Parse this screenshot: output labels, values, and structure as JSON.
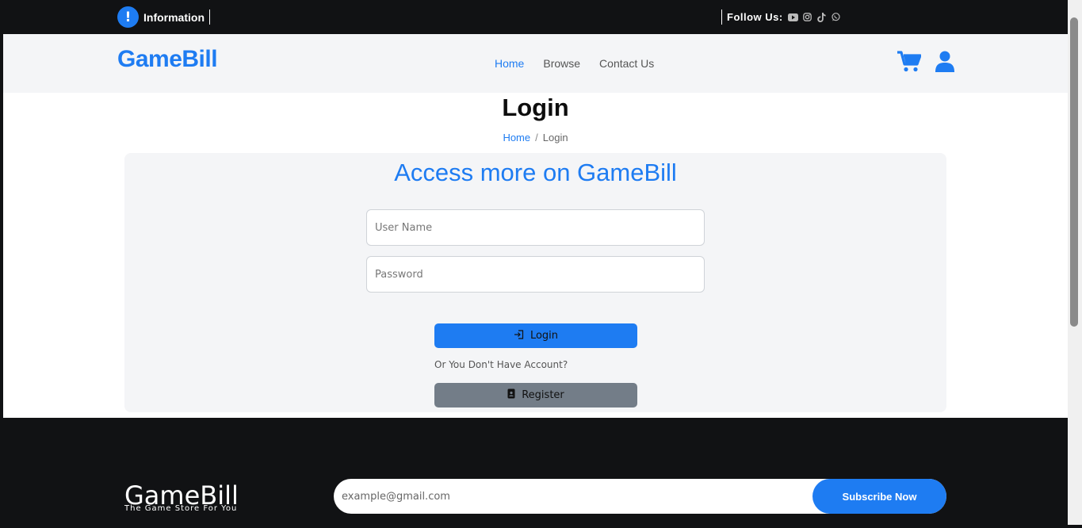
{
  "topbar": {
    "info_label": "Information",
    "info_icon": "exclamation-icon",
    "follow_label": "Follow Us:",
    "social_icons": [
      "youtube-icon",
      "instagram-icon",
      "tiktok-icon",
      "whatsapp-icon"
    ]
  },
  "navbar": {
    "brand": "GameBill",
    "links": [
      {
        "label": "Home",
        "active": true
      },
      {
        "label": "Browse",
        "active": false
      },
      {
        "label": "Contact Us",
        "active": false
      }
    ],
    "icons": [
      "cart-icon",
      "user-icon"
    ]
  },
  "page": {
    "title": "Login",
    "breadcrumb": {
      "home": "Home",
      "separator": "/",
      "current": "Login"
    }
  },
  "form": {
    "heading": "Access more on GameBill",
    "username_placeholder": "User Name",
    "password_placeholder": "Password",
    "login_label": "Login",
    "alt_text": "Or You Don't Have Account?",
    "register_label": "Register"
  },
  "footer": {
    "brand": "GameBill",
    "tagline": "The Game Store For You",
    "email_placeholder": "example@gmail.com",
    "subscribe_label": "Subscribe Now"
  },
  "colors": {
    "accent": "#1e7cf2",
    "dark": "#111214",
    "secondary": "#737d88"
  }
}
